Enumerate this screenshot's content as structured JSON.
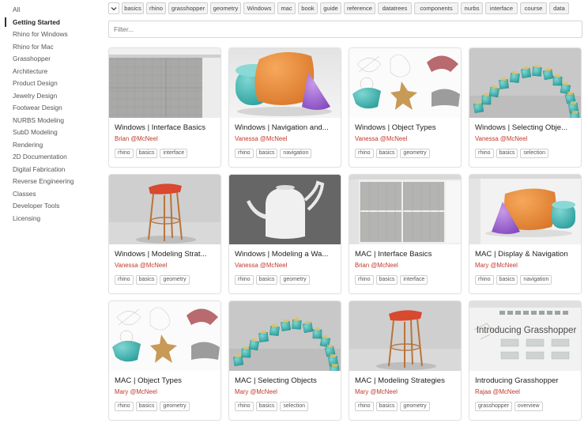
{
  "sidebar": {
    "items": [
      {
        "label": "All"
      },
      {
        "label": "Getting Started"
      },
      {
        "label": "Rhino for Windows"
      },
      {
        "label": "Rhino for Mac"
      },
      {
        "label": "Grasshopper"
      },
      {
        "label": "Architecture"
      },
      {
        "label": "Product Design"
      },
      {
        "label": "Jewelry Design"
      },
      {
        "label": "Footwear Design"
      },
      {
        "label": "NURBS Modeling"
      },
      {
        "label": "SubD Modeling"
      },
      {
        "label": "Rendering"
      },
      {
        "label": "2D Documentation"
      },
      {
        "label": "Digital Fabrication"
      },
      {
        "label": "Reverse Engineering"
      },
      {
        "label": "Classes"
      },
      {
        "label": "Developer Tools"
      },
      {
        "label": "Licensing"
      }
    ],
    "active_label": "Getting Started"
  },
  "tagbar": {
    "dropdown_icon": "chevron-down-icon",
    "tags": [
      "basics",
      "rhino",
      "grasshopper",
      "geometry",
      "Windows",
      "mac",
      "book",
      "guide",
      "reference",
      "datatrees",
      "components",
      "nurbs",
      "interface",
      "course",
      "data"
    ]
  },
  "filter": {
    "placeholder": "Filter...",
    "value": ""
  },
  "cards": [
    {
      "title": "Windows | Interface Basics",
      "author": "Brian @McNeel",
      "tags": [
        "rhino",
        "basics",
        "interface"
      ],
      "thumb": "interface"
    },
    {
      "title": "Windows | Navigation and...",
      "author": "Vanessa @McNeel",
      "tags": [
        "rhino",
        "basics",
        "navigation"
      ],
      "thumb": "shapes"
    },
    {
      "title": "Windows | Object Types",
      "author": "Vanessa @McNeel",
      "tags": [
        "rhino",
        "basics",
        "geometry"
      ],
      "thumb": "objects"
    },
    {
      "title": "Windows | Selecting Obje...",
      "author": "Vanessa @McNeel",
      "tags": [
        "rhino",
        "basics",
        "selection"
      ],
      "thumb": "cubes"
    },
    {
      "title": "Windows | Modeling Strat...",
      "author": "Vanessa @McNeel",
      "tags": [
        "rhino",
        "basics",
        "geometry"
      ],
      "thumb": "stool"
    },
    {
      "title": "Windows | Modeling a Wa...",
      "author": "Vanessa @McNeel",
      "tags": [
        "rhino",
        "basics",
        "geometry"
      ],
      "thumb": "can"
    },
    {
      "title": "MAC | Interface Basics",
      "author": "Brian @McNeel",
      "tags": [
        "rhino",
        "basics",
        "interface"
      ],
      "thumb": "interface-mac"
    },
    {
      "title": "MAC | Display & Navigation",
      "author": "Mary @McNeel",
      "tags": [
        "rhino",
        "basics",
        "navigation"
      ],
      "thumb": "mac-shapes"
    },
    {
      "title": "MAC | Object Types",
      "author": "Mary @McNeel",
      "tags": [
        "rhino",
        "basics",
        "geometry"
      ],
      "thumb": "objects"
    },
    {
      "title": "MAC | Selecting Objects",
      "author": "Mary @McNeel",
      "tags": [
        "rhino",
        "basics",
        "selection"
      ],
      "thumb": "cubes"
    },
    {
      "title": "MAC | Modeling Strategies",
      "author": "Mary @McNeel",
      "tags": [
        "rhino",
        "basics",
        "geometry"
      ],
      "thumb": "stool"
    },
    {
      "title": "Introducing Grasshopper",
      "author": "Rajaa @McNeel",
      "tags": [
        "grasshopper",
        "overview"
      ],
      "thumb": "grasshopper",
      "thumb_text": "Introducing Grasshopper"
    }
  ],
  "colors": {
    "author": "#c0392b",
    "accent_orange": "#e8893a",
    "accent_teal": "#3fb3b0",
    "accent_purple": "#9a5fd0"
  }
}
